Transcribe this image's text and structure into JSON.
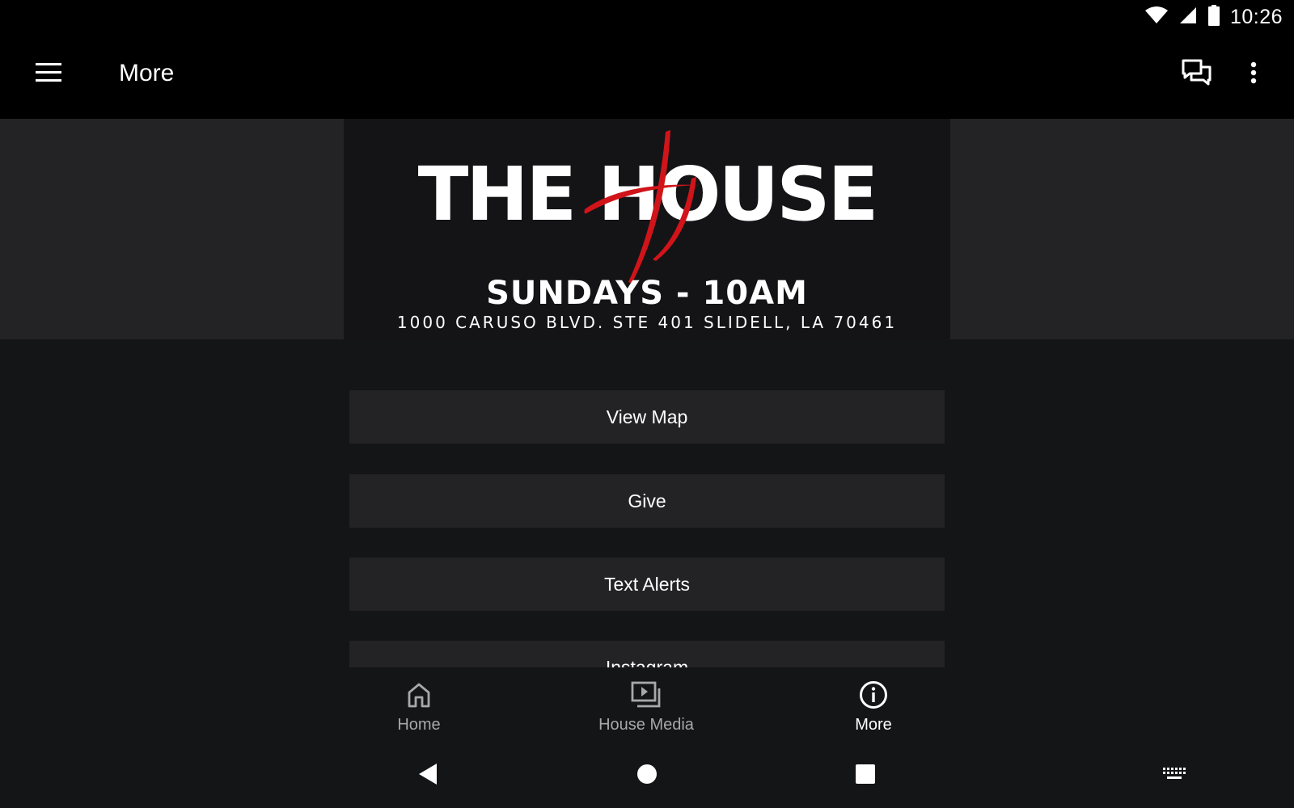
{
  "status_bar": {
    "time": "10:26",
    "icons": [
      "wifi-icon",
      "cell-signal-icon",
      "battery-icon"
    ]
  },
  "app_bar": {
    "title": "More",
    "left_icon": "hamburger-menu-icon",
    "right_icons": [
      "chat-icon",
      "overflow-menu-icon"
    ]
  },
  "banner": {
    "logo_text": "THE HOUSE",
    "logo_accent_color": "#d0141a",
    "schedule": "SUNDAYS - 10AM",
    "address": "1000 CARUSO BLVD. STE 401 SLIDELL, LA 70461"
  },
  "actions": [
    {
      "label": "View Map"
    },
    {
      "label": "Give"
    },
    {
      "label": "Text Alerts"
    },
    {
      "label": "Instagram"
    }
  ],
  "bottom_nav": {
    "items": [
      {
        "label": "Home",
        "icon": "home-icon",
        "active": false
      },
      {
        "label": "House Media",
        "icon": "media-icon",
        "active": false
      },
      {
        "label": "More",
        "icon": "info-icon",
        "active": true
      }
    ]
  },
  "system_nav": {
    "icons": [
      "back-icon",
      "home-circle-icon",
      "recents-icon",
      "keyboard-icon"
    ]
  },
  "colors": {
    "bar_background": "#000000",
    "page_background": "#141516",
    "button_background": "#232325",
    "inactive_nav": "#a8a8aa"
  }
}
